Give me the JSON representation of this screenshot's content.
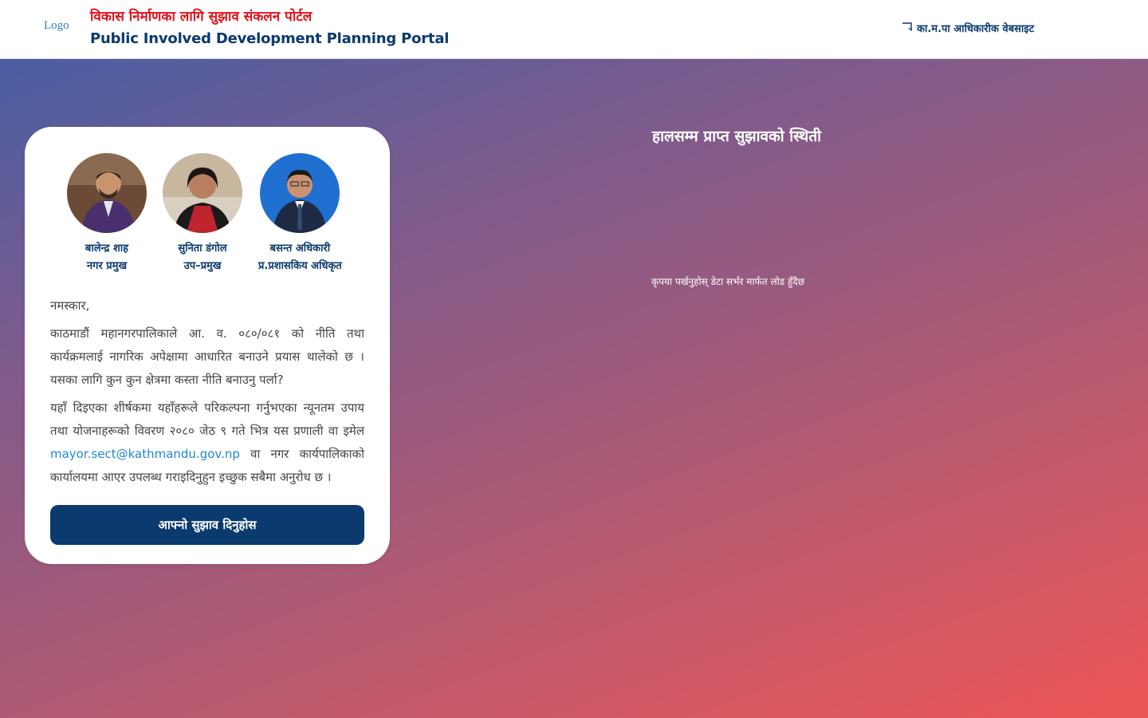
{
  "header": {
    "logo_alt": "Logo",
    "title_np": "विकास निर्माणका लागि सुझाव संकलन पोर्टल",
    "title_en": "Public Involved Development Planning Portal",
    "official_link_label": "का.म.पा आधिकारीक वेबसाइट",
    "official_link_icon": "external-link-icon"
  },
  "leaders": [
    {
      "name": "बालेन्द्र शाह",
      "role": "नगर प्रमुख"
    },
    {
      "name": "सुनिता डंगोल",
      "role": "उप–प्रमुख"
    },
    {
      "name": "बसन्त अधिकारी",
      "role": "प्र.प्रशासकिय अधिकृत"
    }
  ],
  "intro": {
    "greeting": "नमस्कार,",
    "paragraph1": "काठमाडौं महानगरपालिकाले आ. व. ०८०/०८१ को नीति तथा कार्यक्रमलाई नागरिक अपेक्षामा आधारित बनाउने प्रयास थालेको छ । यसका लागि कुन कुन क्षेत्रमा कस्ता नीति बनाउनु पर्ला?",
    "paragraph2_before": "यहाँ दिइएका शीर्षकमा यहाँहरूले परिकल्पना गर्नुभएका न्यूनतम उपाय तथा योजनाहरूको विवरण २०८० जेठ ९ गते भित्र यस प्रणाली वा इमेल",
    "email": "mayor.sect@kathmandu.gov.np",
    "paragraph2_after": "वा नगर कार्यपालिकाको कार्यालयमा आएर उपलब्ध गराइदिनुहुन इच्छुक सबैमा अनुरोध छ ।"
  },
  "submit_button_label": "आफ्नो सुझाव दिनुहोस",
  "status": {
    "title": "हालसम्म प्राप्त सुझावको स्थिती",
    "loading_text": "कृपया पर्खनुहोस् डेटा सर्भर मार्फत लोड हुँदैछ"
  },
  "colors": {
    "brand_navy": "#0b3a6e",
    "title_red": "#e3101a",
    "link_blue": "#1e88d6",
    "gradient_start": "#3f5fa6",
    "gradient_end": "#ee5656"
  }
}
